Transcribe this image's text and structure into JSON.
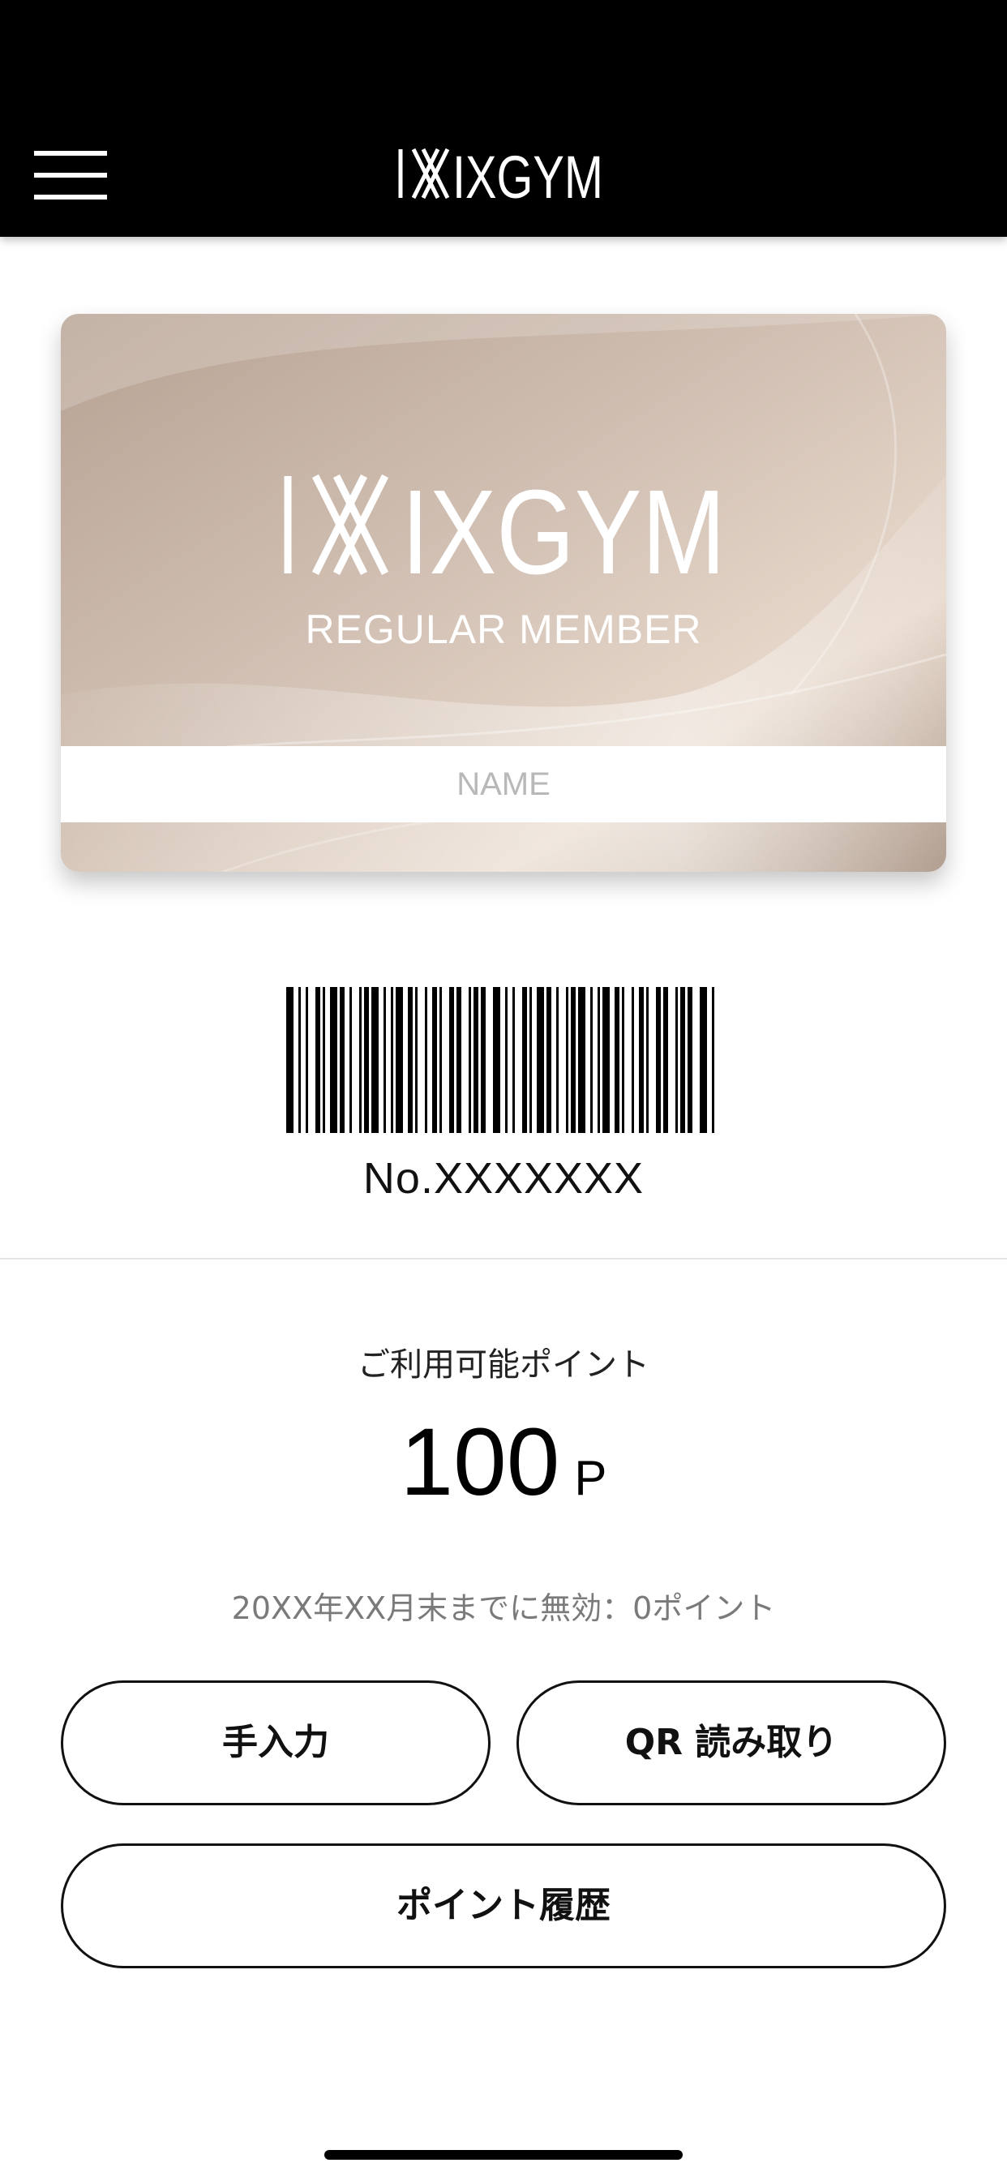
{
  "header": {
    "brand": "IXGYM",
    "menu_icon": "hamburger-menu-icon"
  },
  "card": {
    "brand": "IXGYM",
    "tier": "REGULAR MEMBER",
    "name_placeholder": "NAME"
  },
  "barcode": {
    "number": "No.XXXXXXX"
  },
  "points": {
    "label": "ご利用可能ポイント",
    "value": "100",
    "unit": "P",
    "expire_note": "20XX年XX月末までに無効：0ポイント"
  },
  "actions": {
    "manual_label": "手入力",
    "qr_label": "QR 読み取り",
    "history_label": "ポイント履歴"
  },
  "colors": {
    "header_bg": "#000000",
    "card_tone": "#c9b6a7",
    "button_border": "#111111"
  }
}
